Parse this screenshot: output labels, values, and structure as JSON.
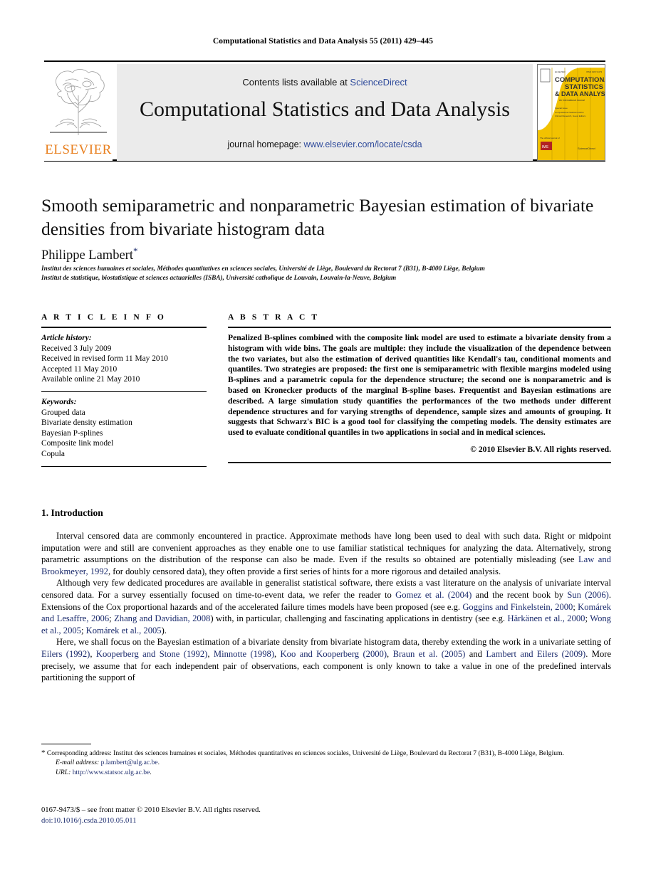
{
  "running_head": "Computational Statistics and Data Analysis 55 (2011) 429–445",
  "masthead": {
    "publisher_name": "ELSEVIER",
    "contents_prefix": "Contents lists available at ",
    "contents_link": "ScienceDirect",
    "journal_title": "Computational Statistics and Data Analysis",
    "homepage_prefix": "journal homepage: ",
    "homepage_link": "www.elsevier.com/locate/csda",
    "cover": {
      "line1": "COMPUTATIONAL",
      "line2": "STATISTICS",
      "line3": "& DATA ANALYSIS",
      "line4": "An International Journal",
      "footer": "ScienceDirect"
    },
    "link_color": "#2f4b9b",
    "brand_color": "#E87F1E",
    "panel_color": "#ebebeb"
  },
  "article": {
    "title": "Smooth semiparametric and nonparametric Bayesian estimation of bivariate densities from bivariate histogram data",
    "author": "Philippe Lambert",
    "author_marker": "*",
    "affiliations": [
      "Institut des sciences humaines et sociales, Méthodes quantitatives en sciences sociales, Université de Liège, Boulevard du Rectorat 7 (B31), B-4000 Liège, Belgium",
      "Institut de statistique, biostatistique et sciences actuarielles (ISBA), Université catholique de Louvain, Louvain-la-Neuve, Belgium"
    ]
  },
  "info": {
    "heading": "A R T I C L E   I N F O",
    "history_label": "Article history:",
    "history": [
      "Received 3 July 2009",
      "Received in revised form 11 May 2010",
      "Accepted 11 May 2010",
      "Available online 21 May 2010"
    ],
    "keywords_label": "Keywords:",
    "keywords": [
      "Grouped data",
      "Bivariate density estimation",
      "Bayesian P-splines",
      "Composite link model",
      "Copula"
    ]
  },
  "abstract": {
    "heading": "A B S T R A C T",
    "text": "Penalized B-splines combined with the composite link model are used to estimate a bivariate density from a histogram with wide bins. The goals are multiple: they include the visualization of the dependence between the two variates, but also the estimation of derived quantities like Kendall's tau, conditional moments and quantiles. Two strategies are proposed: the first one is semiparametric with flexible margins modeled using B-splines and a parametric copula for the dependence structure; the second one is nonparametric and is based on Kronecker products of the marginal B-spline bases. Frequentist and Bayesian estimations are described. A large simulation study quantifies the performances of the two methods under different dependence structures and for varying strengths of dependence, sample sizes and amounts of grouping. It suggests that Schwarz's BIC is a good tool for classifying the competing models. The density estimates are used to evaluate conditional quantiles in two applications in social and in medical sciences.",
    "copyright": "© 2010 Elsevier B.V. All rights reserved."
  },
  "section": {
    "number_title": "1. Introduction",
    "paragraphs": [
      {
        "segments": [
          {
            "t": "Interval censored data are commonly encountered in practice. Approximate methods have long been used to deal with such data. Right or midpoint imputation were and still are convenient approaches as they enable one to use familiar statistical techniques for analyzing the data. Alternatively, strong parametric assumptions on the distribution of the response can also be made. Even if the results so obtained are potentially misleading (see ",
            "link": false
          },
          {
            "t": "Law and Brookmeyer, 1992",
            "link": true
          },
          {
            "t": ", for doubly censored data), they often provide a first series of hints for a more rigorous and detailed analysis.",
            "link": false
          }
        ]
      },
      {
        "segments": [
          {
            "t": "Although very few dedicated procedures are available in generalist statistical software, there exists a vast literature on the analysis of univariate interval censored data. For a survey essentially focused on time-to-event data, we refer the reader to ",
            "link": false
          },
          {
            "t": "Gomez et al. (2004)",
            "link": true
          },
          {
            "t": " and the recent book by ",
            "link": false
          },
          {
            "t": "Sun (2006)",
            "link": true
          },
          {
            "t": ". Extensions of the Cox proportional hazards and of the accelerated failure times models have been proposed (see e.g. ",
            "link": false
          },
          {
            "t": "Goggins and Finkelstein, 2000",
            "link": true
          },
          {
            "t": "; ",
            "link": false
          },
          {
            "t": "Komárek and Lesaffre, 2006",
            "link": true
          },
          {
            "t": "; ",
            "link": false
          },
          {
            "t": "Zhang and Davidian, 2008",
            "link": true
          },
          {
            "t": ") with, in particular, challenging and fascinating applications in dentistry (see e.g. ",
            "link": false
          },
          {
            "t": "Härkänen et al., 2000",
            "link": true
          },
          {
            "t": "; ",
            "link": false
          },
          {
            "t": "Wong et al., 2005",
            "link": true
          },
          {
            "t": "; ",
            "link": false
          },
          {
            "t": "Komárek et al., 2005",
            "link": true
          },
          {
            "t": ").",
            "link": false
          }
        ]
      },
      {
        "segments": [
          {
            "t": "Here, we shall focus on the Bayesian estimation of a bivariate density from bivariate histogram data, thereby extending the work in a univariate setting of ",
            "link": false
          },
          {
            "t": "Eilers (1992)",
            "link": true
          },
          {
            "t": ", ",
            "link": false
          },
          {
            "t": "Kooperberg and Stone (1992)",
            "link": true
          },
          {
            "t": ", ",
            "link": false
          },
          {
            "t": "Minnotte (1998)",
            "link": true
          },
          {
            "t": ", ",
            "link": false
          },
          {
            "t": "Koo and Kooperberg (2000)",
            "link": true
          },
          {
            "t": ", ",
            "link": false
          },
          {
            "t": "Braun et al. (2005)",
            "link": true
          },
          {
            "t": " and ",
            "link": false
          },
          {
            "t": "Lambert and Eilers (2009)",
            "link": true
          },
          {
            "t": ". More precisely, we assume that for each independent pair of observations, each component is only known to take a value in one of the predefined intervals partitioning the support of",
            "link": false
          }
        ]
      }
    ]
  },
  "footnote": {
    "marker": "*",
    "corresponding": " Corresponding address: Institut des sciences humaines et sociales, Méthodes quantitatives en sciences sociales, Université de Liège, Boulevard du Rectorat 7 (B31), B-4000 Liège, Belgium.",
    "email_label": "E-mail address:",
    "email_value": "p.lambert@ulg.ac.be",
    "url_label": "URL:",
    "url_value": "http://www.statsoc.ulg.ac.be"
  },
  "imprint": {
    "line1": "0167-9473/$ – see front matter © 2010 Elsevier B.V. All rights reserved.",
    "doi": "doi:10.1016/j.csda.2010.05.011"
  }
}
